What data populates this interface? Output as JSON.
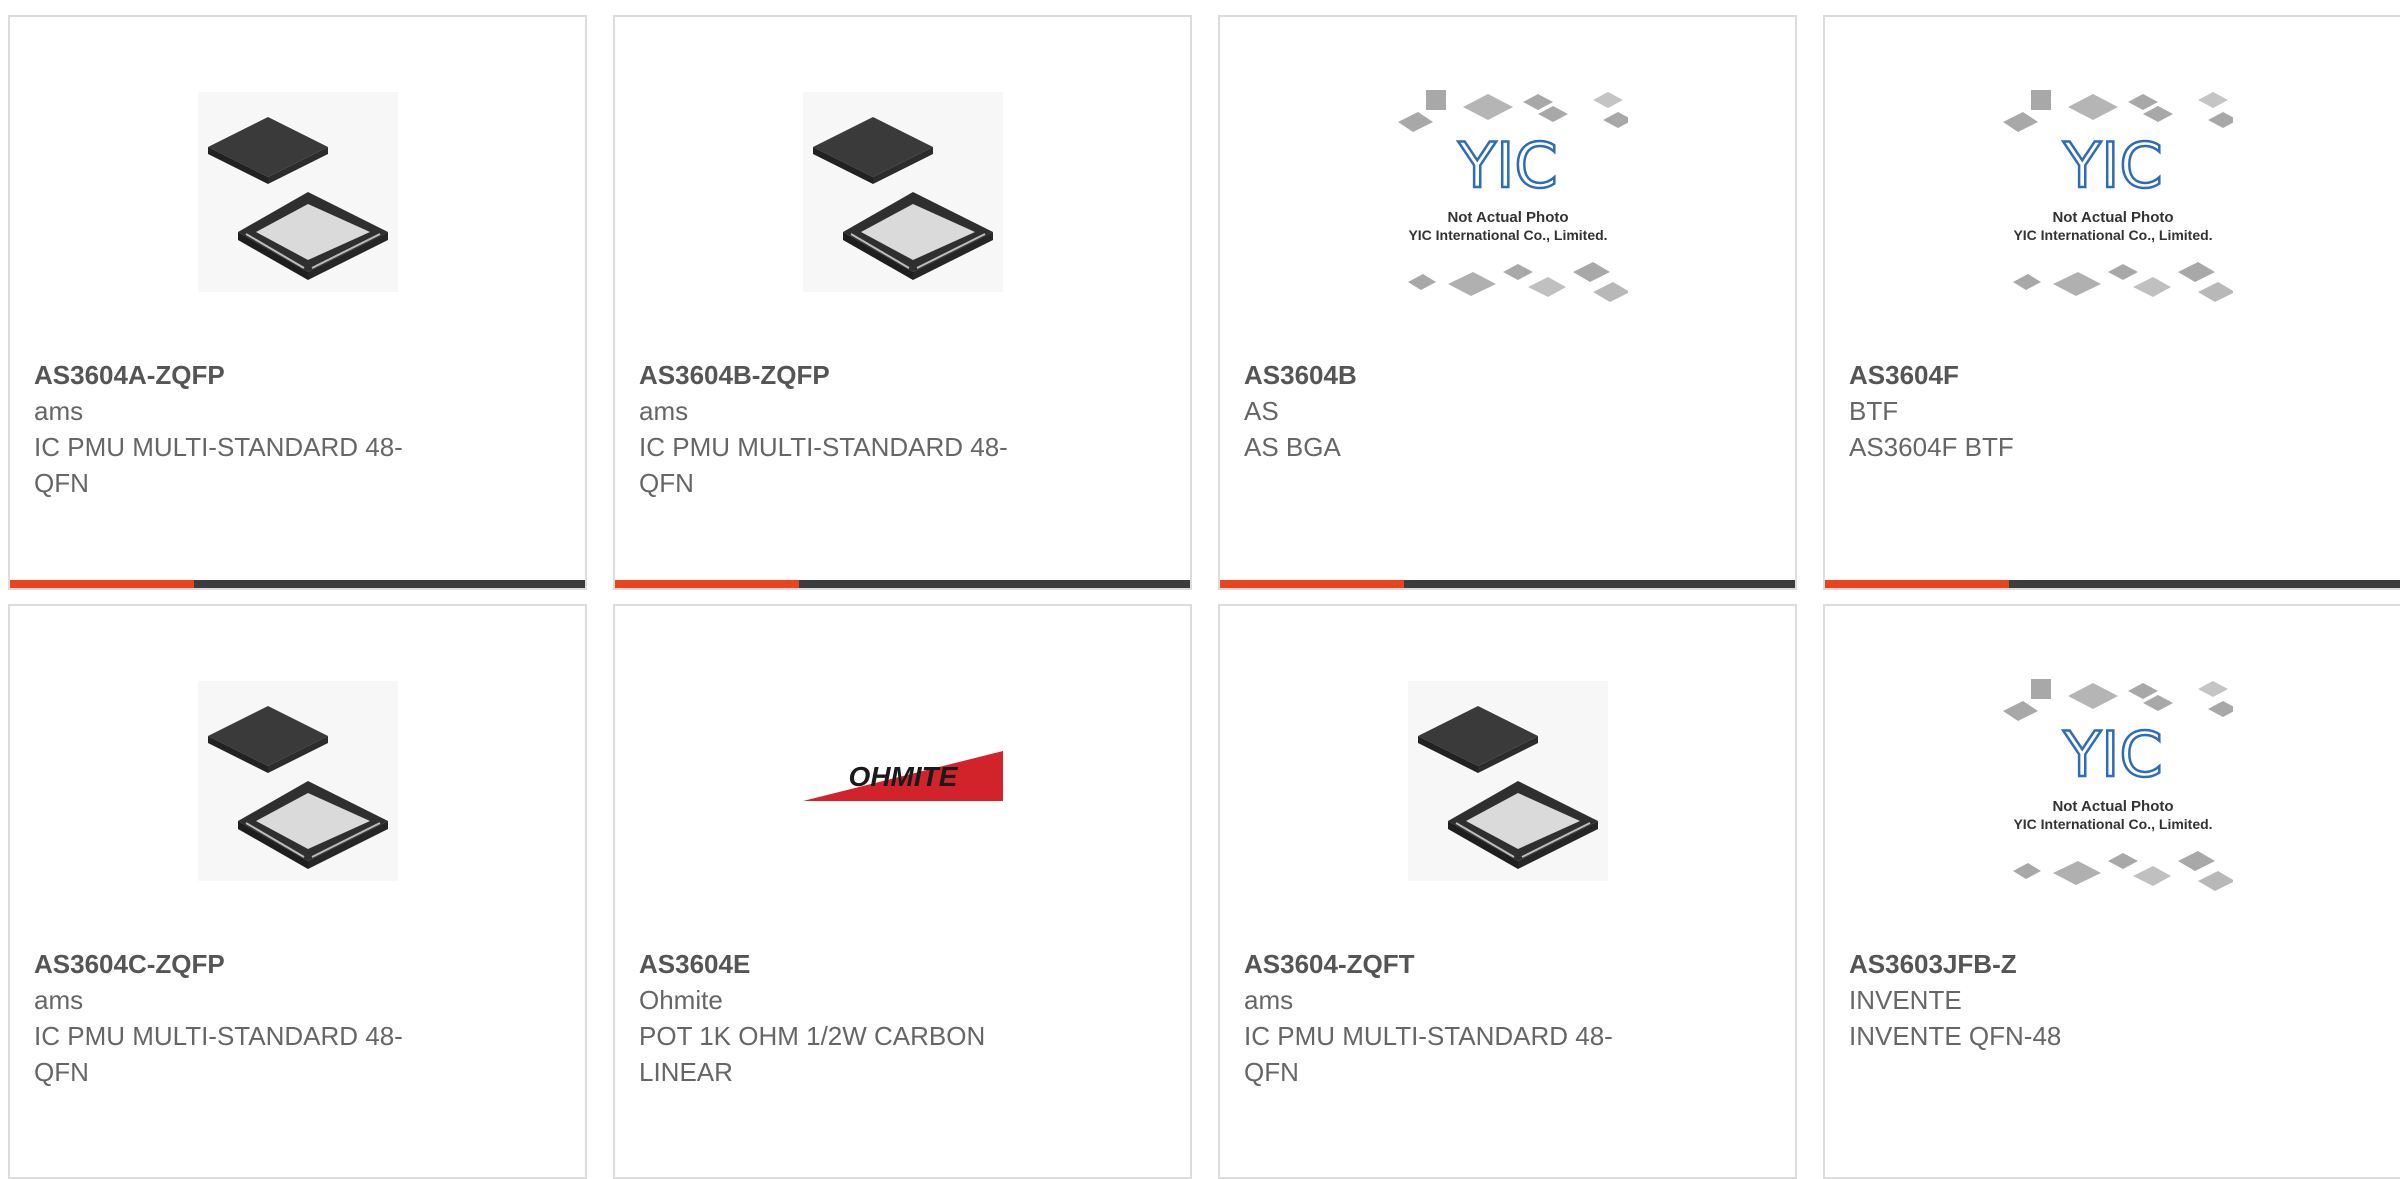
{
  "colors": {
    "accent": "#e8441d",
    "bar_dark": "#3c3c3c",
    "border": "#dcdcdc",
    "text": "#666666"
  },
  "products": [
    {
      "part": "AS3604A-ZQFP",
      "manufacturer": "ams",
      "description": "IC PMU MULTI-STANDARD 48-\nQFN",
      "image": "qfn-chip-image",
      "has_bar": true
    },
    {
      "part": "AS3604B-ZQFP",
      "manufacturer": "ams",
      "description": "IC PMU MULTI-STANDARD 48-\nQFN",
      "image": "qfn-chip-image",
      "has_bar": true
    },
    {
      "part": "AS3604B",
      "manufacturer": "AS",
      "description": "AS BGA",
      "image": "yic-placeholder-image",
      "has_bar": true
    },
    {
      "part": "AS3604F",
      "manufacturer": "BTF",
      "description": "AS3604F BTF",
      "image": "yic-placeholder-image",
      "has_bar": true
    },
    {
      "part": "AS3604C-ZQFP",
      "manufacturer": "ams",
      "description": "IC PMU MULTI-STANDARD 48-\nQFN",
      "image": "qfn-chip-image",
      "has_bar": false
    },
    {
      "part": "AS3604E",
      "manufacturer": "Ohmite",
      "description": "POT 1K OHM 1/2W CARBON\nLINEAR",
      "image": "ohmite-logo-image",
      "has_bar": false
    },
    {
      "part": "AS3604-ZQFT",
      "manufacturer": "ams",
      "description": "IC PMU MULTI-STANDARD 48-\nQFN",
      "image": "qfn-chip-image",
      "has_bar": false
    },
    {
      "part": "AS3603JFB-Z",
      "manufacturer": "INVENTE",
      "description": "INVENTE QFN-48",
      "image": "yic-placeholder-image",
      "has_bar": false
    }
  ],
  "placeholder_image_text": {
    "line1": "Not Actual Photo",
    "line2": "YIC International Co., Limited.",
    "logo": "YIC"
  },
  "ohmite_logo_text": "OHMITE"
}
